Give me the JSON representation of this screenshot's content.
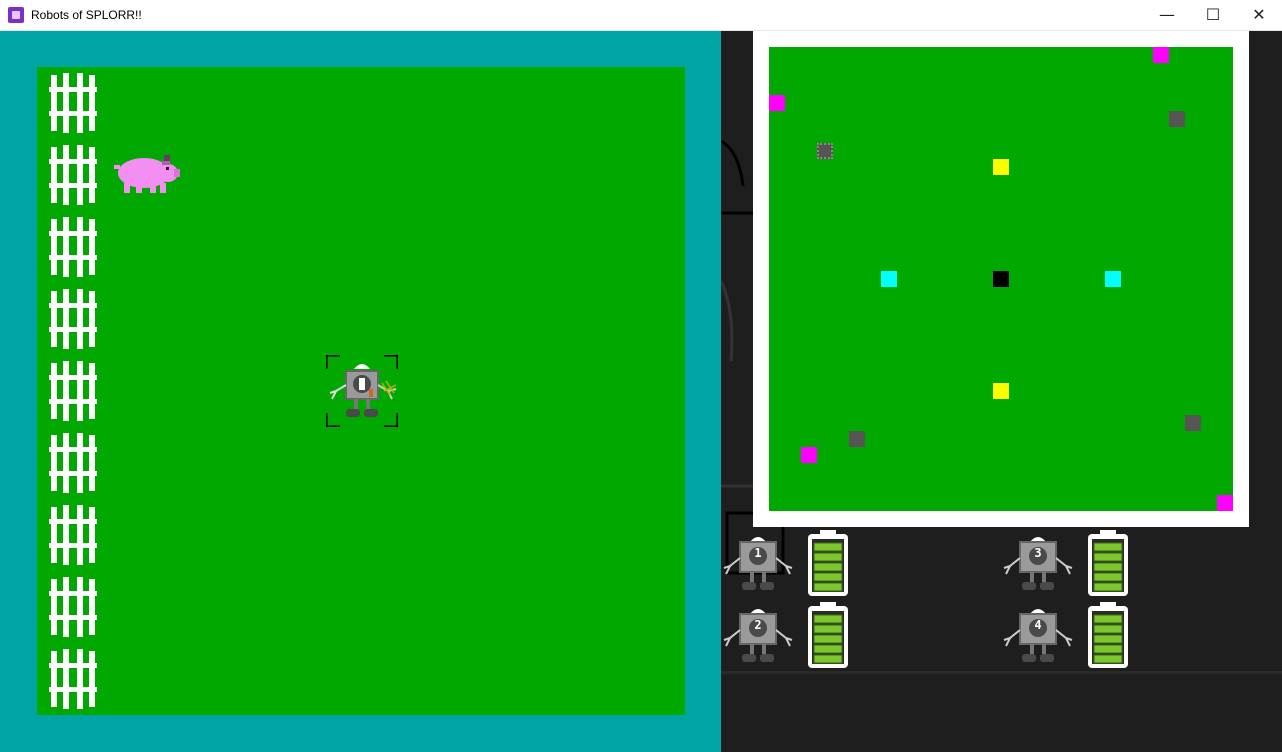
{
  "window": {
    "title": "Robots of SPLORR!!",
    "minimize_glyph": "—",
    "maximize_glyph": "☐",
    "close_glyph": "✕"
  },
  "field": {
    "fence_count": 9,
    "pig": "pig",
    "selected_robot_number": "1"
  },
  "minimap": {
    "colors": {
      "field": "#00a800",
      "pig": "#ff00ff",
      "fence": "#555555",
      "yellow": "#ffff00",
      "cyan": "#00ffff",
      "center": "#000000"
    }
  },
  "robots": [
    {
      "number": "1",
      "battery_bars": 5
    },
    {
      "number": "2",
      "battery_bars": 5
    },
    {
      "number": "3",
      "battery_bars": 5
    },
    {
      "number": "4",
      "battery_bars": 5
    }
  ]
}
